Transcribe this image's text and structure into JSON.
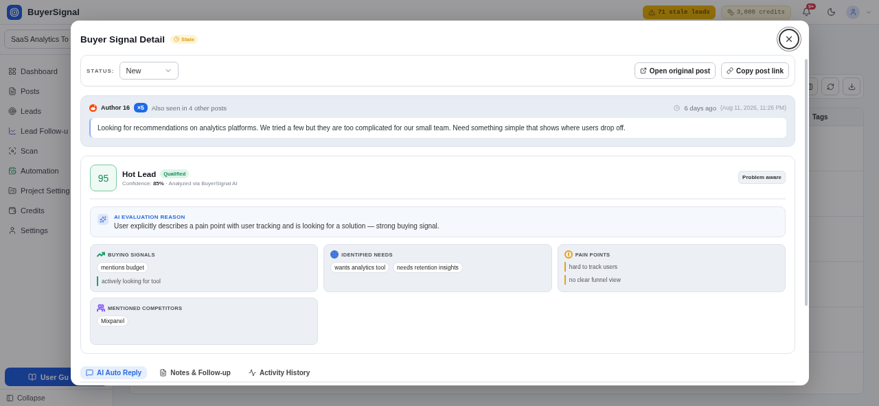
{
  "app": {
    "name": "BuyerSignal"
  },
  "header": {
    "stale_badge": "71 stale leads",
    "credits": "3,000 credits",
    "notifications": "9+"
  },
  "sidebar": {
    "project": "SaaS Analytics To",
    "items": [
      {
        "label": "Dashboard"
      },
      {
        "label": "Posts"
      },
      {
        "label": "Leads"
      },
      {
        "label": "Lead Follow-u"
      },
      {
        "label": "Scan"
      },
      {
        "label": "Automation"
      },
      {
        "label": "Project Setting"
      },
      {
        "label": "Credits"
      },
      {
        "label": "Settings"
      }
    ],
    "guide_button": "User Gu",
    "collapse": "Collapse"
  },
  "table": {
    "columns": [
      "Tags"
    ]
  },
  "modal": {
    "title": "Buyer Signal Detail",
    "badge": "Stale",
    "status": {
      "label": "STATUS:",
      "value": "New"
    },
    "actions": [
      "Open original post",
      "Copy post link"
    ],
    "post": {
      "author": "Author 16",
      "count": "×5",
      "seen": "Also seen in 4 other posts",
      "age": "6 days ago",
      "date": "(Aug 11, 2026, 11:26 PM)",
      "text": "Looking for recommendations on analytics platforms. We tried a few but they are too complicated for our small team. Need something simple that shows where users drop off."
    },
    "lead": {
      "score": "95",
      "title": "Hot Lead",
      "badge": "Qualified",
      "confidence": "Confidence: **85%** · Analyzed via BuyerSignal AI",
      "stage": "Problem aware",
      "reason": {
        "title": "AI EVALUATION REASON",
        "text": "User explicitly describes a pain point with user tracking and is looking for a solution — strong buying signal."
      },
      "groups": [
        {
          "title": "BUYING SIGNALS",
          "color": "#1f9d6b",
          "items": [
            {
              "kind": "chip",
              "text": "mentions budget"
            },
            {
              "kind": "line",
              "text": "actively looking for tool"
            }
          ]
        },
        {
          "title": "IDENTIFIED NEEDS",
          "color": "#3b6fd8",
          "items": [
            {
              "kind": "chip",
              "text": "wants analytics tool"
            },
            {
              "kind": "chip",
              "text": "needs retention insights"
            }
          ]
        },
        {
          "title": "PAIN POINTS",
          "color": "#e3a21a",
          "items": [
            {
              "kind": "line",
              "text": "hard to track users"
            },
            {
              "kind": "line",
              "text": "no clear funnel view"
            }
          ]
        },
        {
          "title": "MENTIONED COMPETITORS",
          "color": "#8b5cf6",
          "items": [
            {
              "kind": "chip",
              "text": "Mixpanel"
            }
          ]
        }
      ]
    },
    "tabs": [
      {
        "label": "AI Auto Reply",
        "selected": true
      },
      {
        "label": "Notes & Follow-up",
        "selected": false
      },
      {
        "label": "Activity History",
        "selected": false
      }
    ]
  }
}
